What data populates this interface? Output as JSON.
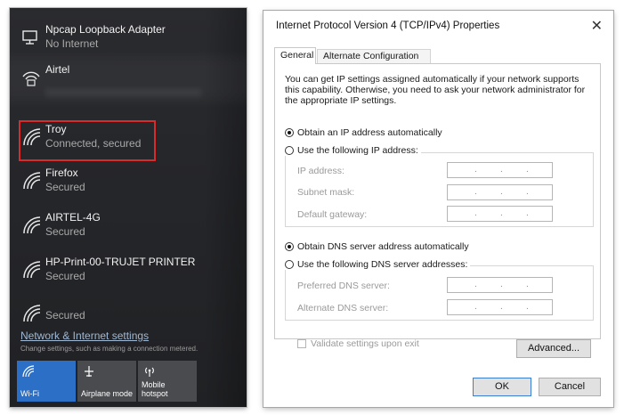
{
  "flyout": {
    "networks": [
      {
        "name": "Npcap Loopback Adapter",
        "status": "No Internet",
        "icon": "monitor-icon"
      },
      {
        "name": "Airtel",
        "status": "",
        "icon": "wifi-locked-icon"
      },
      {
        "name": "Troy",
        "status": "Connected, secured",
        "icon": "wifi-icon",
        "selected": true
      },
      {
        "name": "Firefox",
        "status": "Secured",
        "icon": "wifi-icon"
      },
      {
        "name": "AIRTEL-4G",
        "status": "Secured",
        "icon": "wifi-icon"
      },
      {
        "name": "HP-Print-00-TRUJET PRINTER",
        "status": "Secured",
        "icon": "wifi-icon"
      },
      {
        "name": "",
        "status": "Secured",
        "icon": "wifi-icon"
      }
    ],
    "settings_link": "Network & Internet settings",
    "settings_desc": "Change settings, such as making a connection metered.",
    "tiles": [
      {
        "label": "Wi-Fi",
        "icon": "wifi-icon",
        "active": true
      },
      {
        "label": "Airplane mode",
        "icon": "airplane-icon",
        "active": false
      },
      {
        "label": "Mobile\nhotspot",
        "icon": "hotspot-icon",
        "active": false
      }
    ],
    "colors": {
      "selection_border": "#d92b2b",
      "wifi_tile": "#2b6fc7"
    }
  },
  "dialog": {
    "title": "Internet Protocol Version 4 (TCP/IPv4) Properties",
    "close": "✕",
    "tabs": [
      "General",
      "Alternate Configuration"
    ],
    "intro": "You can get IP settings assigned automatically if your network supports this capability. Otherwise, you need to ask your network administrator for the appropriate IP settings.",
    "ip_auto": "Obtain an IP address automatically",
    "ip_manual": "Use the following IP address:",
    "ip_fields": [
      "IP address:",
      "Subnet mask:",
      "Default gateway:"
    ],
    "dns_auto": "Obtain DNS server address automatically",
    "dns_manual": "Use the following DNS server addresses:",
    "dns_fields": [
      "Preferred DNS server:",
      "Alternate DNS server:"
    ],
    "ip_placeholder": ".       .       .",
    "validate": "Validate settings upon exit",
    "advanced": "Advanced...",
    "ok": "OK",
    "cancel": "Cancel"
  }
}
